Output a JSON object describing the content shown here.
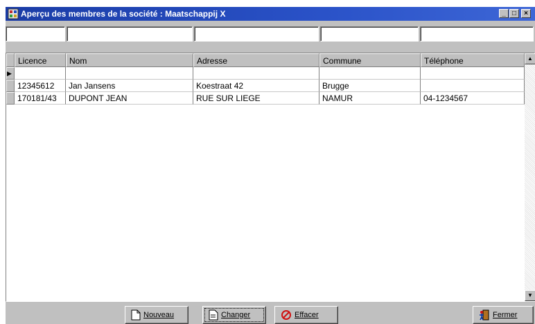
{
  "window": {
    "title": "Aperçu des membres de la société : Maatschappij X",
    "controls": {
      "minimize": "_",
      "maximize": "□",
      "close": "×"
    }
  },
  "filters": [
    "",
    "",
    "",
    "",
    ""
  ],
  "table": {
    "columns": [
      "Licence",
      "Nom",
      "Adresse",
      "Commune",
      "Téléphone"
    ],
    "rows": [
      [
        "",
        "",
        "",
        "",
        ""
      ],
      [
        "12345612",
        "Jan Jansens",
        "Koestraat 42",
        "Brugge",
        ""
      ],
      [
        "170181/43",
        "DUPONT JEAN",
        "RUE SUR LIEGE",
        "NAMUR",
        "04-1234567"
      ]
    ],
    "current_row_indicator": "▶"
  },
  "buttons": {
    "new": "Nouveau",
    "change": "Changer",
    "delete": "Effacer",
    "close": "Fermer"
  },
  "icons": {
    "app": "app-grid-icon",
    "new": "new-document-icon",
    "change": "edit-document-icon",
    "delete": "prohibited-icon",
    "close": "exit-door-icon"
  }
}
